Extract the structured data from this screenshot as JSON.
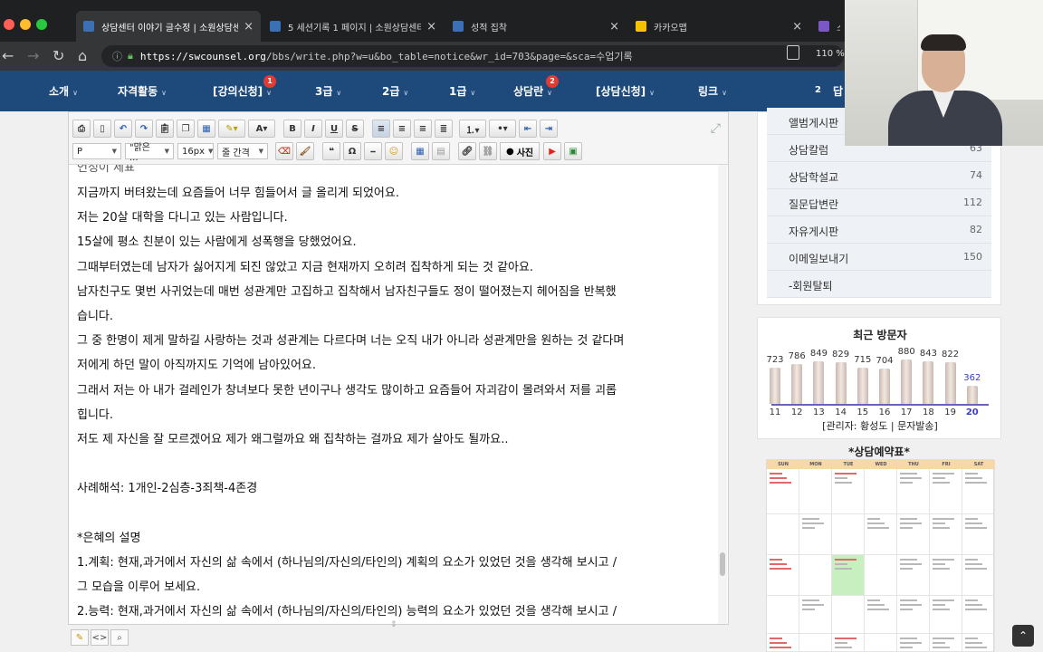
{
  "browser": {
    "tabs": [
      {
        "title": "상담센터 이야기 글수정 | 소원상담센",
        "active": true,
        "favicon_color": "#3b6fb6"
      },
      {
        "title": "5 세션기록 1 페이지 | 소원상담센터",
        "active": false,
        "favicon_color": "#3b6fb6"
      },
      {
        "title": "성적 집착",
        "active": false,
        "favicon_color": "#3b6fb6"
      },
      {
        "title": "카카오맵",
        "active": false,
        "favicon_color": "#f5c400"
      },
      {
        "title": "스",
        "active": false,
        "favicon_color": "#7b58c8"
      }
    ],
    "url_host": "https://swcounsel.org",
    "url_path": "/bbs/write.php?w=u&bo_table=notice&wr_id=703&page=&sca=수업기록",
    "zoom": "110 %"
  },
  "site_nav": {
    "items": [
      {
        "label": "소개",
        "badge": ""
      },
      {
        "label": "자격활동",
        "badge": ""
      },
      {
        "label": "[강의신청]",
        "badge": "1"
      },
      {
        "label": "3급",
        "badge": ""
      },
      {
        "label": "2급",
        "badge": ""
      },
      {
        "label": "1급",
        "badge": ""
      },
      {
        "label": "상담란",
        "badge": "2"
      },
      {
        "label": "[상담신청]",
        "badge": ""
      },
      {
        "label": "링크",
        "badge": ""
      }
    ],
    "right_num": "2",
    "right_text": "답"
  },
  "editor": {
    "format_select": "P",
    "font_select": "\"맑은 ...",
    "size_select": "16px",
    "line_select": "줄 간격",
    "photo_button": "사진",
    "partial_top": "언정이 제표",
    "lines": [
      " 지금까지 버텨왔는데 요즘들어 너무 힘들어서 글 올리게 되었어요.",
      "저는 20살 대학을 다니고 있는 사람입니다.",
      "15살에 평소 친분이 있는 사람에게 성폭행을 당했었어요.",
      "그때부터였는데 남자가 싫어지게 되진 않았고 지금 현재까지 오히려 집착하게 되는 것 같아요.",
      "남자친구도 몇번 사귀었는데 매번 성관계만 고집하고 집착해서 남자친구들도 정이 떨어졌는지 헤어짐을 반복했",
      "습니다.",
      "그 중 한명이 제게 말하길 사랑하는 것과 성관계는 다르다며 너는 오직 내가 아니라 성관계만을 원하는 것 같다며",
      "저에게 하던 말이 아직까지도 기억에 남아있어요.",
      "그래서 저는 아 내가 걸레인가 창녀보다 못한 년이구나 생각도 많이하고 요즘들어 자괴감이 몰려와서 저를 괴롭",
      "힙니다.",
      "저도 제 자신을 잘 모르겠어요 제가 왜그럴까요 왜 집착하는 걸까요 제가 살아도 될까요..",
      "",
      "사례해석: 1개인-2심층-3죄책-4존경",
      "",
      "*은혜의 설명",
      "1.계획: 현재,과거에서 자신의 삶 속에서 (하나님의/자신의/타인의) 계획의 요소가 있었던 것을 생각해 보시고 /",
      "그 모습을 이루어 보세요.",
      "2.능력: 현재,과거에서 자신의 삶 속에서 (하나님의/자신의/타인의) 능력의 요소가 있었던 것을 생각해 보시고 /"
    ]
  },
  "sidebar_menu": [
    {
      "label": "앨범게시판",
      "count": ""
    },
    {
      "label": "상담칼럼",
      "count": "63"
    },
    {
      "label": "상담학설교",
      "count": "74"
    },
    {
      "label": "질문답변란",
      "count": "112"
    },
    {
      "label": "자유게시판",
      "count": "82"
    },
    {
      "label": "이메일보내기",
      "count": "150"
    },
    {
      "label": "-회원탈퇴",
      "count": ""
    }
  ],
  "visitors": {
    "title": "최근 방문자",
    "admin": "[관리자: 황성도 | 문자발송]"
  },
  "chart_data": {
    "type": "bar",
    "title": "최근 방문자",
    "categories": [
      "11",
      "12",
      "13",
      "14",
      "15",
      "16",
      "17",
      "18",
      "19",
      "20"
    ],
    "values": [
      723,
      786,
      849,
      829,
      715,
      704,
      880,
      843,
      822,
      362
    ],
    "highlight_color": "#3a3ad0",
    "ylim": [
      0,
      900
    ]
  },
  "calendar": {
    "title": "*상담예약표*",
    "days": [
      "SUN",
      "MON",
      "TUE",
      "WED",
      "THU",
      "FRI",
      "SAT"
    ]
  }
}
